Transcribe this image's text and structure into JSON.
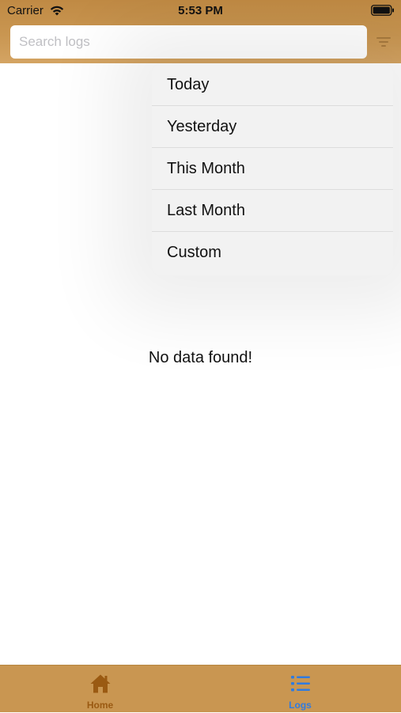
{
  "status_bar": {
    "carrier": "Carrier",
    "time": "5:53 PM"
  },
  "search": {
    "placeholder": "Search logs",
    "value": ""
  },
  "filter_menu": {
    "items": [
      {
        "label": "Today"
      },
      {
        "label": "Yesterday"
      },
      {
        "label": "This Month"
      },
      {
        "label": "Last Month"
      },
      {
        "label": "Custom"
      }
    ]
  },
  "main": {
    "empty_message": "No data found!"
  },
  "tab_bar": {
    "tabs": [
      {
        "label": "Home",
        "icon": "home-icon",
        "color": "#9a5a12"
      },
      {
        "label": "Logs",
        "icon": "list-icon",
        "color": "#2f7be0",
        "selected": true
      }
    ]
  },
  "colors": {
    "header_brown": "#c99651",
    "active_blue": "#2f7be0",
    "inactive_brown": "#9a5a12"
  }
}
